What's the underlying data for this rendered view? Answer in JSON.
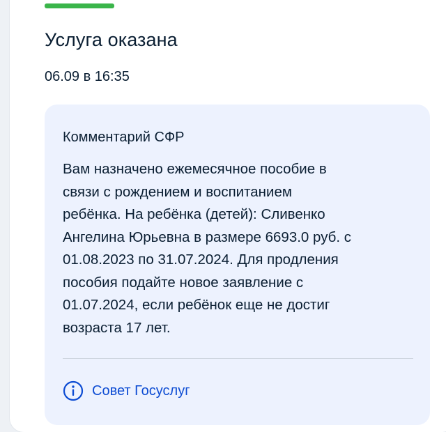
{
  "status": {
    "title": "Услуга оказана",
    "date": "06.09 в 16:35",
    "bar_color": "#3ab54a"
  },
  "comment": {
    "heading": "Комментарий СФР",
    "lines": [
      "Вам назначено ежемесячное пособие в",
      "связи с рождением и воспитанием",
      "ребёнка. На ребёнка (детей): Сливенко",
      "Ангелина Юрьевна в размере 6693.0 руб. с",
      "01.08.2023 по 31.07.2024. Для продления",
      "пособия подайте новое заявление с",
      "01.07.2024, если ребёнок еще не достиг",
      "возраста 17 лет."
    ]
  },
  "advice": {
    "label": "Совет Госуслуг",
    "icon": "info-icon",
    "color": "#0d4cd3"
  }
}
